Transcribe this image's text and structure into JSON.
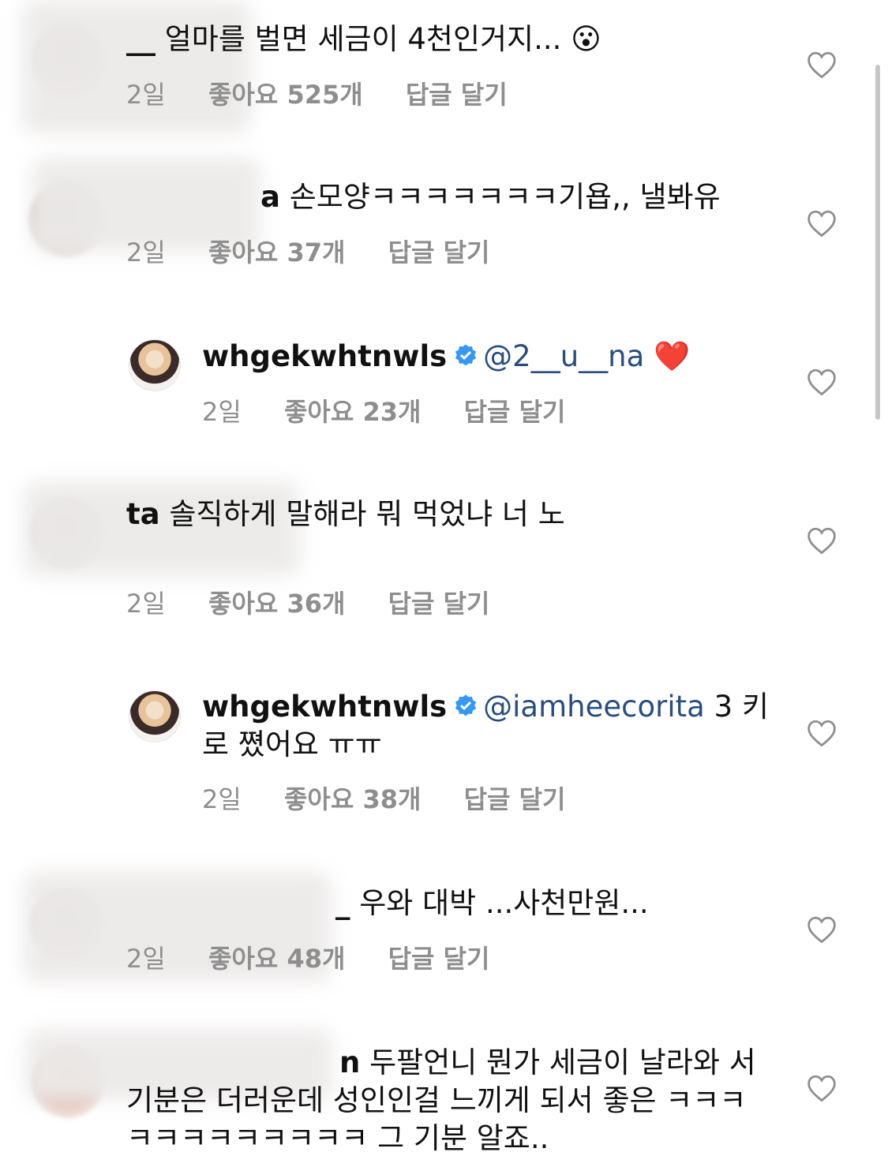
{
  "comments": [
    {
      "username": "__",
      "text": "얼마를 벌면 세금이 4천인거지...",
      "emoji": "😮",
      "time": "2일",
      "likes": "좋아요 525개",
      "reply": "답글 달기"
    },
    {
      "username": "a",
      "text": "손모양ㅋㅋㅋㅋㅋㅋㅋ기욥,, 낼봐유",
      "time": "2일",
      "likes": "좋아요 37개",
      "reply": "답글 달기"
    },
    {
      "username": "whgekwhtnwls",
      "mention": "@2__u__na",
      "text": "",
      "emoji": "❤️",
      "time": "2일",
      "likes": "좋아요 23개",
      "reply": "답글 달기"
    },
    {
      "username": "ta",
      "text": "솔직하게 말해라 뭐 먹었냐 너 노",
      "time": "2일",
      "likes": "좋아요 36개",
      "reply": "답글 달기"
    },
    {
      "username": "whgekwhtnwls",
      "mention": "@iamheecorita",
      "text": "3 키로 쪘어요 ㅠㅠ",
      "time": "2일",
      "likes": "좋아요 38개",
      "reply": "답글 달기"
    },
    {
      "username": "_",
      "text": "우와 대박 ...사천만원...",
      "time": "2일",
      "likes": "좋아요 48개",
      "reply": "답글 달기"
    },
    {
      "username": "n",
      "text": "두팔언니 뭔가 세금이 날라와 서 기분은 더러운데 성인인걸 느끼게 되서 좋은 ㅋㅋㅋㅋㅋㅋㅋㅋㅋㅋㅋㅋ 그 기분 알죠.."
    }
  ],
  "icons": {
    "heart": "heart-outline-icon",
    "verified": "verified-badge-icon"
  },
  "colors": {
    "mention": "#2b4d7d",
    "meta": "#8e8e8e",
    "verified": "#3897f0"
  }
}
